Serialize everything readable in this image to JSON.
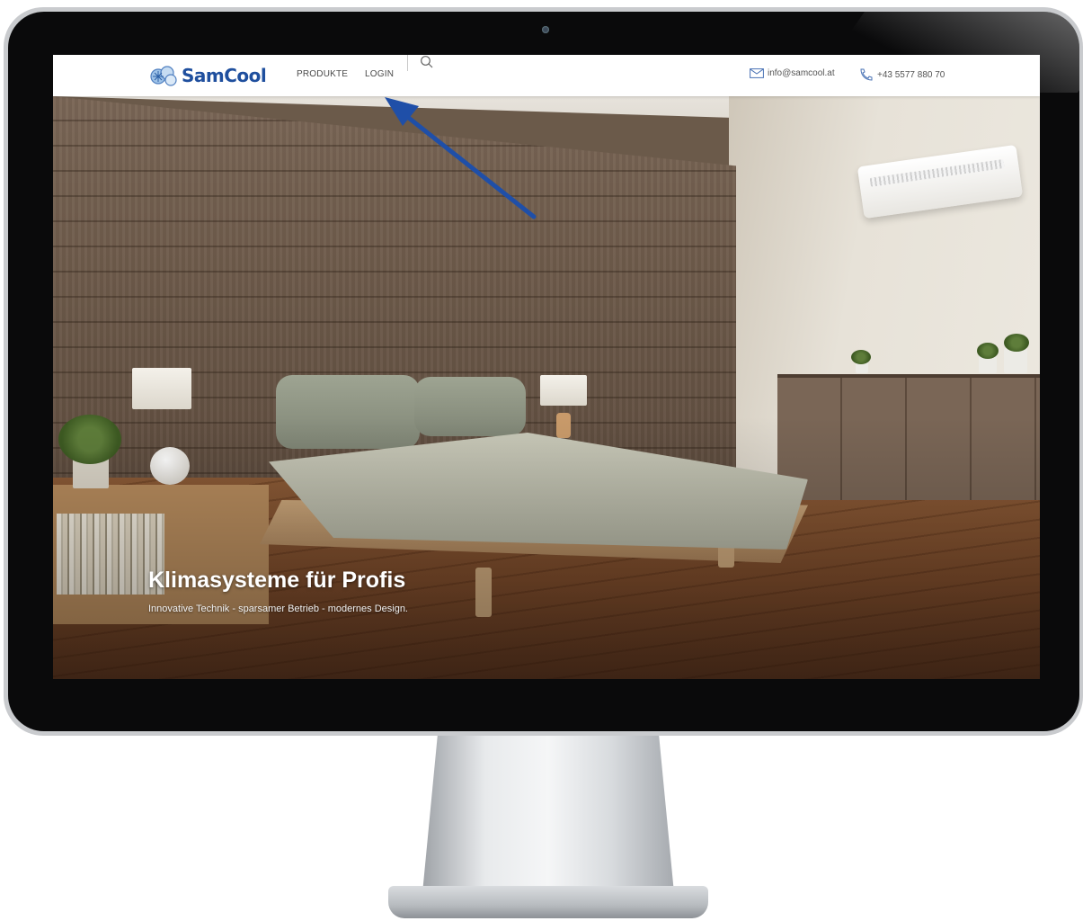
{
  "site": {
    "brand": "SamCool",
    "nav": [
      {
        "label": "PRODUKTE"
      },
      {
        "label": "LOGIN"
      }
    ],
    "contact": {
      "email": "info@samcool.at",
      "phone": "+43 5577 880 70"
    }
  },
  "hero": {
    "title": "Klimasysteme für Profis",
    "subtitle": "Innovative Technik - sparsamer Betrieb - modernes Design."
  },
  "colors": {
    "brand_blue": "#1f4f9e",
    "annotation_arrow": "#1f4fa8"
  },
  "icons": {
    "search": "search-icon",
    "email": "envelope-icon",
    "phone": "phone-icon",
    "logo": "snowflake-logo-icon"
  }
}
